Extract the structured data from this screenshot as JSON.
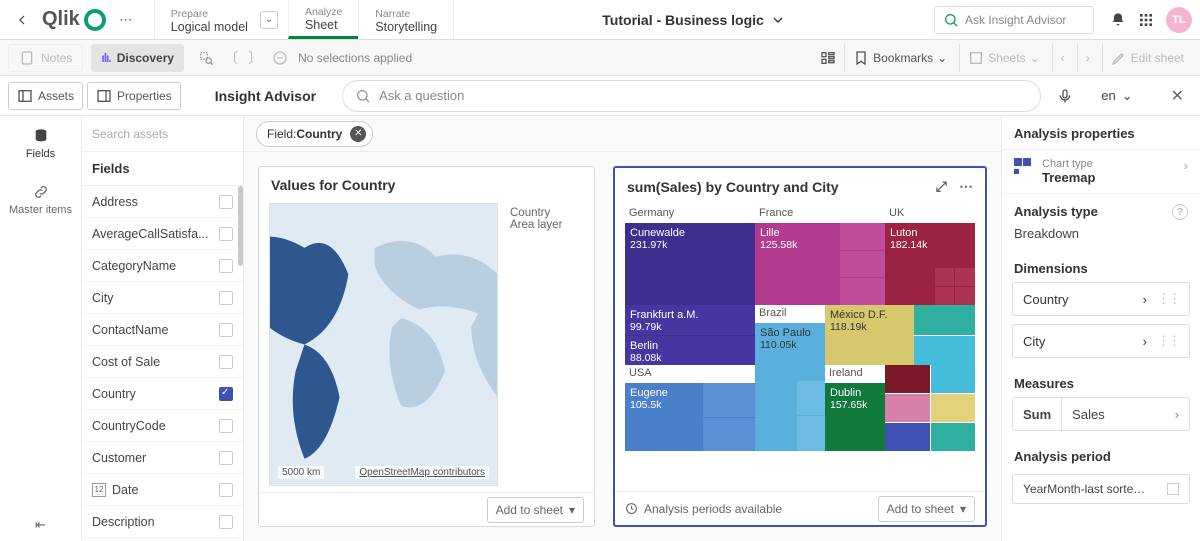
{
  "header": {
    "logo_text": "Qlik",
    "app_title": "Tutorial - Business logic",
    "search_placeholder": "Ask Insight Advisor",
    "avatar_initials": "TL",
    "tabs": {
      "prepare": {
        "small": "Prepare",
        "big": "Logical model"
      },
      "analyze": {
        "small": "Analyze",
        "big": "Sheet"
      },
      "narrate": {
        "small": "Narrate",
        "big": "Storytelling"
      }
    }
  },
  "toolbar": {
    "notes": "Notes",
    "discovery": "Discovery",
    "no_selections": "No selections applied",
    "bookmarks": "Bookmarks",
    "sheets": "Sheets",
    "edit_sheet": "Edit sheet"
  },
  "third": {
    "assets": "Assets",
    "properties": "Properties",
    "insight": "Insight Advisor",
    "question_placeholder": "Ask a question",
    "lang": "en"
  },
  "left_tabs": {
    "fields": "Fields",
    "master": "Master items"
  },
  "assets": {
    "search_placeholder": "Search assets",
    "group": "Fields",
    "fields": [
      {
        "label": "Address",
        "checked": false
      },
      {
        "label": "AverageCallSatisfa...",
        "checked": false
      },
      {
        "label": "CategoryName",
        "checked": false
      },
      {
        "label": "City",
        "checked": false
      },
      {
        "label": "ContactName",
        "checked": false
      },
      {
        "label": "Cost of Sale",
        "checked": false
      },
      {
        "label": "Country",
        "checked": true
      },
      {
        "label": "CountryCode",
        "checked": false
      },
      {
        "label": "Customer",
        "checked": false
      },
      {
        "label": "Date",
        "checked": false,
        "date": true
      },
      {
        "label": "Description",
        "checked": false
      }
    ]
  },
  "filter_pill": {
    "prefix": "Field:",
    "value": "Country"
  },
  "card_map": {
    "title": "Values for Country",
    "legend1": "Country",
    "legend2": "Area layer",
    "scale": "5000 km",
    "attrib": "OpenStreetMap contributors",
    "add": "Add to sheet"
  },
  "card_tree": {
    "title": "sum(Sales) by Country and City",
    "footer_note": "Analysis periods available",
    "add": "Add to sheet",
    "headers": {
      "germany": "Germany",
      "france": "France",
      "uk": "UK",
      "brazil": "Brazil",
      "usa": "USA",
      "ireland": "Ireland"
    }
  },
  "chart_data": {
    "type": "treemap",
    "title": "sum(Sales) by Country and City",
    "hierarchy": [
      "Country",
      "City"
    ],
    "measure": "sum(Sales)",
    "series": [
      {
        "country": "Germany",
        "city": "Cunewalde",
        "value": 231970
      },
      {
        "country": "Germany",
        "city": "Frankfurt a.M.",
        "value": 99790
      },
      {
        "country": "Germany",
        "city": "Berlin",
        "value": 88080
      },
      {
        "country": "France",
        "city": "Lille",
        "value": 125580
      },
      {
        "country": "UK",
        "city": "Luton",
        "value": 182140
      },
      {
        "country": "Brazil",
        "city": "São Paulo",
        "value": 110050
      },
      {
        "country": "Mexico",
        "city": "México D.F.",
        "value": 118190
      },
      {
        "country": "USA",
        "city": "Eugene",
        "value": 105500
      },
      {
        "country": "Ireland",
        "city": "Dublin",
        "value": 157650
      }
    ]
  },
  "tree_labels": {
    "cunewalde_n": "Cunewalde",
    "cunewalde_v": "231.97k",
    "frankfurt_n": "Frankfurt a.M.",
    "frankfurt_v": "99.79k",
    "berlin_n": "Berlin",
    "berlin_v": "88.08k",
    "lille_n": "Lille",
    "lille_v": "125.58k",
    "luton_n": "Luton",
    "luton_v": "182.14k",
    "saopaulo_n": "São Paulo",
    "saopaulo_v": "110.05k",
    "mexico_n": "México D.F.",
    "mexico_v": "118.19k",
    "eugene_n": "Eugene",
    "eugene_v": "105.5k",
    "dublin_n": "Dublin",
    "dublin_v": "157.65k"
  },
  "props": {
    "title": "Analysis properties",
    "chart_type_lbl": "Chart type",
    "chart_type_val": "Treemap",
    "analysis_type_lbl": "Analysis type",
    "analysis_type_val": "Breakdown",
    "dimensions_lbl": "Dimensions",
    "dim1": "Country",
    "dim2": "City",
    "measures_lbl": "Measures",
    "meas_agg": "Sum",
    "meas_field": "Sales",
    "period_lbl": "Analysis period",
    "period_val": "YearMonth-last sorte…"
  }
}
